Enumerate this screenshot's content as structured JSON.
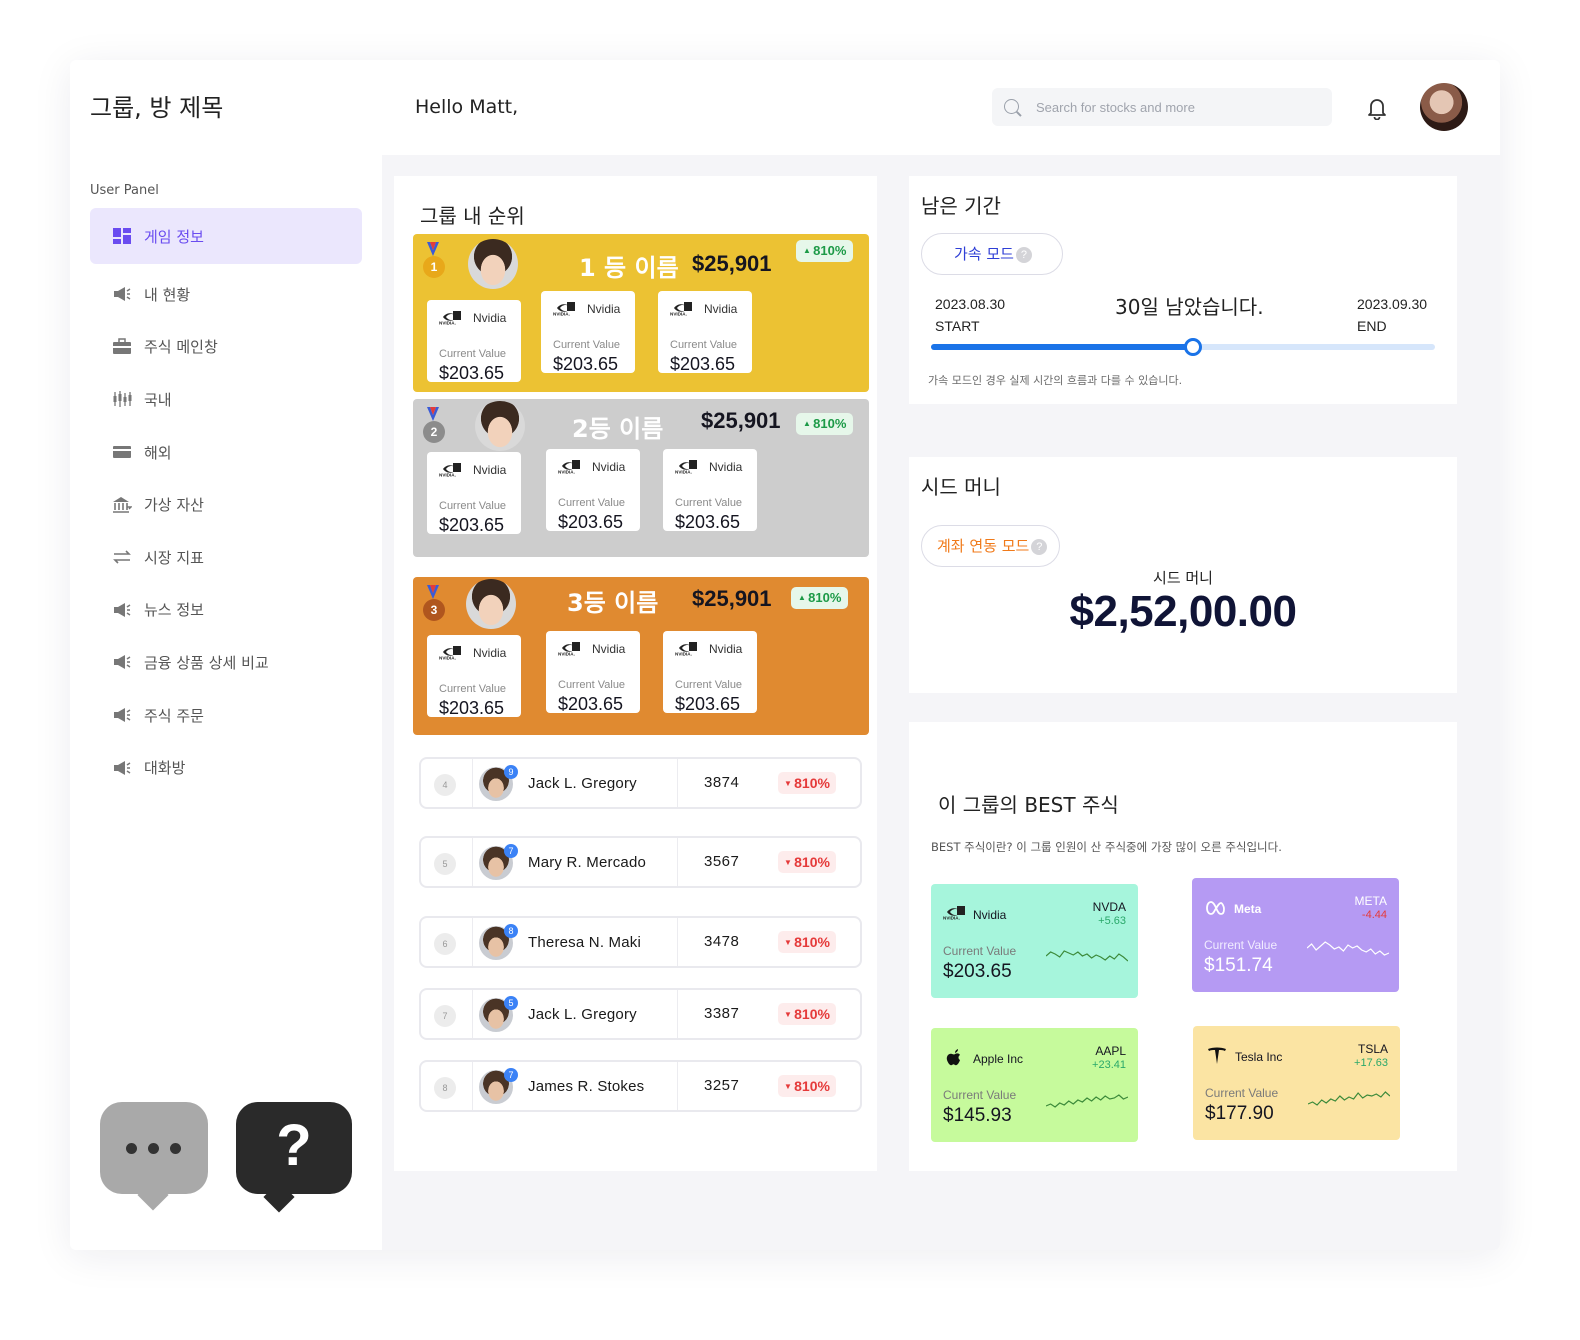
{
  "app": {
    "title": "그룹, 방 제목",
    "greeting": "Hello Matt,"
  },
  "search": {
    "placeholder": "Search for stocks and more"
  },
  "sidebar": {
    "caption": "User Panel",
    "items": [
      {
        "label": "게임 정보",
        "icon": "dashboard-icon"
      },
      {
        "label": "내 현황",
        "icon": "megaphone-icon"
      },
      {
        "label": "주식 메인창",
        "icon": "briefcase-icon"
      },
      {
        "label": "국내",
        "icon": "candlestick-icon"
      },
      {
        "label": "해외",
        "icon": "card-icon"
      },
      {
        "label": "가상 자산",
        "icon": "bank-icon"
      },
      {
        "label": "시장 지표",
        "icon": "swap-icon"
      },
      {
        "label": "뉴스 정보",
        "icon": "megaphone-icon"
      },
      {
        "label": "금융 상품 상세 비교",
        "icon": "megaphone-icon"
      },
      {
        "label": "주식 주문",
        "icon": "megaphone-icon"
      },
      {
        "label": "대화방",
        "icon": "megaphone-icon"
      }
    ]
  },
  "ranking": {
    "title": "그룹 내 순위",
    "top": [
      {
        "rank": "1",
        "name": "1 등 이름",
        "value": "$25,901",
        "change": "810%",
        "color": "#ecc233",
        "stocks": [
          {
            "name": "Nvidia",
            "label": "Current Value",
            "price": "$203.65"
          },
          {
            "name": "Nvidia",
            "label": "Current Value",
            "price": "$203.65"
          },
          {
            "name": "Nvidia",
            "label": "Current Value",
            "price": "$203.65"
          }
        ]
      },
      {
        "rank": "2",
        "name": "2등 이름",
        "value": "$25,901",
        "change": "810%",
        "color": "#cdcdcd",
        "stocks": [
          {
            "name": "Nvidia",
            "label": "Current Value",
            "price": "$203.65"
          },
          {
            "name": "Nvidia",
            "label": "Current Value",
            "price": "$203.65"
          },
          {
            "name": "Nvidia",
            "label": "Current Value",
            "price": "$203.65"
          }
        ]
      },
      {
        "rank": "3",
        "name": "3등 이름",
        "value": "$25,901",
        "change": "810%",
        "color": "#e08a30",
        "stocks": [
          {
            "name": "Nvidia",
            "label": "Current Value",
            "price": "$203.65"
          },
          {
            "name": "Nvidia",
            "label": "Current Value",
            "price": "$203.65"
          },
          {
            "name": "Nvidia",
            "label": "Current Value",
            "price": "$203.65"
          }
        ]
      }
    ],
    "rows": [
      {
        "rank": "4",
        "badge": "9",
        "name": "Jack L. Gregory",
        "score": "3874",
        "change": "810%"
      },
      {
        "rank": "5",
        "badge": "7",
        "name": "Mary R. Mercado",
        "score": "3567",
        "change": "810%"
      },
      {
        "rank": "6",
        "badge": "8",
        "name": "Theresa N. Maki",
        "score": "3478",
        "change": "810%"
      },
      {
        "rank": "7",
        "badge": "5",
        "name": "Jack L. Gregory",
        "score": "3387",
        "change": "810%"
      },
      {
        "rank": "8",
        "badge": "7",
        "name": "James R. Stokes",
        "score": "3257",
        "change": "810%"
      }
    ]
  },
  "period": {
    "title": "남은 기간",
    "mode": "가속 모드",
    "mode_help": "?",
    "start_date": "2023.08.30",
    "start_label": "START",
    "end_date": "2023.09.30",
    "end_label": "END",
    "remaining": "30일 남았습니다.",
    "progress": 0.52,
    "note": "가속 모드인 경우 실제 시간의 흐름과 다를 수 있습니다."
  },
  "seed": {
    "title": "시드 머니",
    "mode": "계좌 연동 모드",
    "mode_help": "?",
    "label": "시드 머니",
    "amount": "$2,52,00.00"
  },
  "best": {
    "title": "이 그룹의 BEST 주식",
    "desc": "BEST 주식이란? 이 그룹 인원이 산 주식중에 가장 많이 오른 주식입니다.",
    "stocks": [
      {
        "name": "Nvidia",
        "ticker": "NVDA",
        "change": "+5.63",
        "label": "Current Value",
        "price": "$203.65",
        "bg": "#a6f5dc",
        "change_color": "#2aa86a",
        "text": "#151520"
      },
      {
        "name": "Meta",
        "ticker": "META",
        "change": "-4.44",
        "label": "Current Value",
        "price": "$151.74",
        "bg": "#b59af3",
        "change_color": "#e53a3a",
        "text": "#ffffff"
      },
      {
        "name": "Apple Inc",
        "ticker": "AAPL",
        "change": "+23.41",
        "label": "Current Value",
        "price": "$145.93",
        "bg": "#c6fa9c",
        "change_color": "#2aa86a",
        "text": "#151520"
      },
      {
        "name": "Tesla Inc",
        "ticker": "TSLA",
        "change": "+17.63",
        "label": "Current Value",
        "price": "$177.90",
        "bg": "#fbe4a3",
        "change_color": "#2aa86a",
        "text": "#151520"
      }
    ]
  },
  "colors": {
    "accent": "#6a4cf0",
    "accent_bg": "#ebe7fd",
    "progress": "#1a73e8",
    "up": "#1c9a47",
    "down": "#e53a3a",
    "mode_blue": "#2f3fd6",
    "mode_orange": "#f07a1a"
  }
}
